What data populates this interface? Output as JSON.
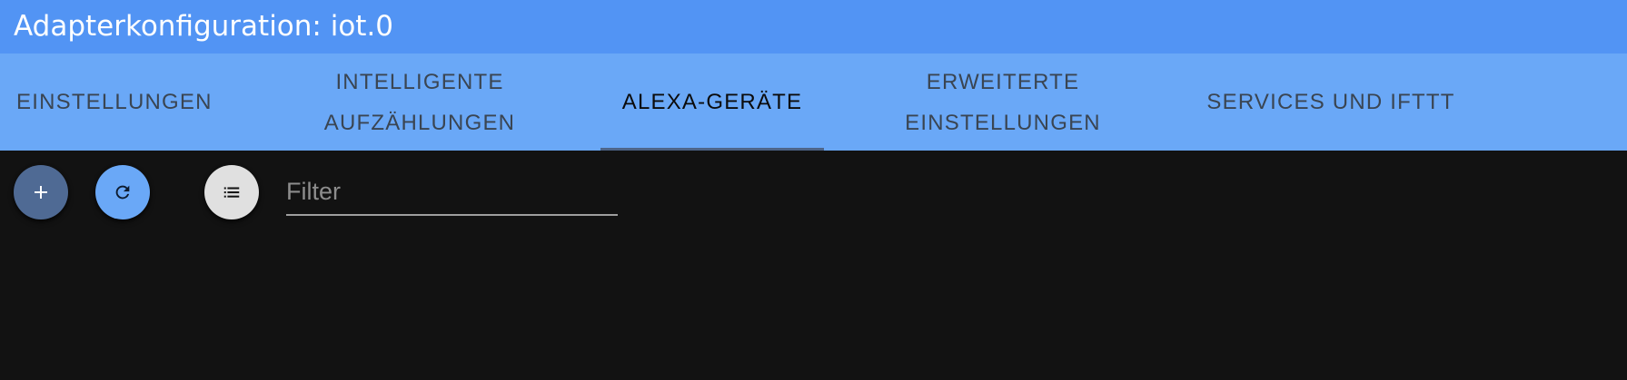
{
  "window": {
    "title": "Adapterkonfiguration: iot.0"
  },
  "tabs": [
    {
      "label": "EINSTELLUNGEN",
      "active": false
    },
    {
      "label": "INTELLIGENTE\nAUFZÄHLUNGEN",
      "active": false
    },
    {
      "label": "ALEXA-GERÄTE",
      "active": true
    },
    {
      "label": "ERWEITERTE\nEINSTELLUNGEN",
      "active": false
    },
    {
      "label": "SERVICES UND IFTTT",
      "active": false
    }
  ],
  "toolbar": {
    "add_icon": "plus-icon",
    "refresh_icon": "refresh-icon",
    "list_icon": "list-icon",
    "filter_placeholder": "Filter",
    "filter_value": ""
  },
  "colors": {
    "titlebar": "#5294f4",
    "tabbar": "#6aa8f7",
    "background": "#121212",
    "add_button": "#4f6a94",
    "refresh_button": "#6aa8f7",
    "list_button": "#e0e0e0"
  }
}
